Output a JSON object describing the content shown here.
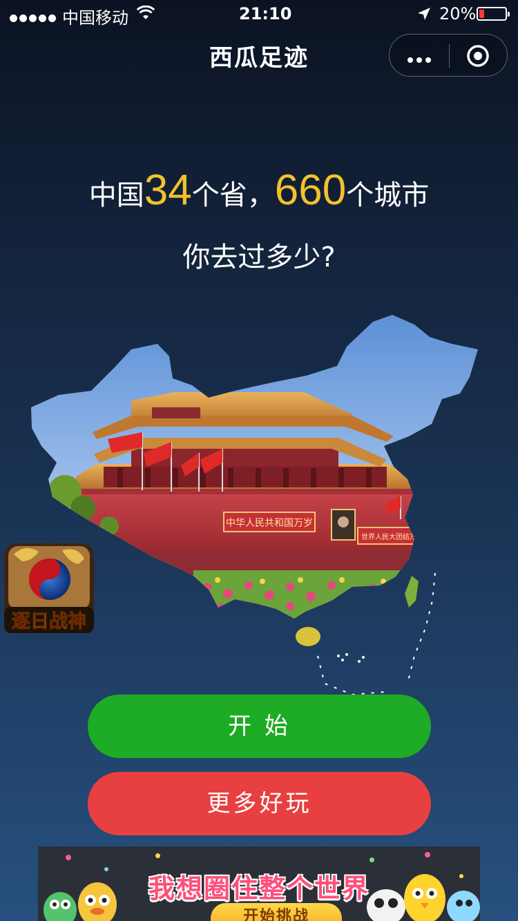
{
  "status_bar": {
    "carrier": "中国移动",
    "time": "21:10",
    "battery": "20%",
    "battery_level": 0.2,
    "battery_color": "#ff3b30",
    "icons": [
      "signal-dots-icon",
      "wifi-icon",
      "location-arrow-icon",
      "battery-icon"
    ]
  },
  "nav": {
    "title": "西瓜足迹",
    "capsule_icons": [
      "more-dots-icon",
      "close-target-icon"
    ]
  },
  "headline": {
    "prefix": "中国",
    "provinces_count": "34",
    "mid": "个省，",
    "cities_count": "660",
    "suffix": "个城市",
    "question": "你去过多少?",
    "number_color": "#f3c22b"
  },
  "illustration": {
    "image": "china-map-with-tiananmen",
    "gate_banner_left": "中华人民共和国万岁",
    "gate_banner_right": "世界人民大团结万岁"
  },
  "float_ad": {
    "title": "逐日战神"
  },
  "buttons": {
    "start": "开 始",
    "more": "更多好玩",
    "start_color": "#1eab25",
    "more_color": "#e84040"
  },
  "banner_ad": {
    "title": "我想圈住整个世界",
    "cta": "开始挑战"
  }
}
